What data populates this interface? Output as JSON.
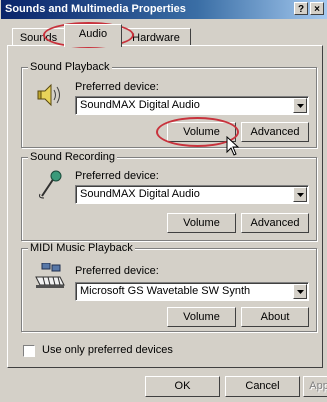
{
  "window": {
    "title": "Sounds and Multimedia Properties",
    "help_button": "?",
    "close_button": "×"
  },
  "tabs": [
    {
      "label": "Sounds",
      "active": false
    },
    {
      "label": "Audio",
      "active": true
    },
    {
      "label": "Hardware",
      "active": false
    }
  ],
  "sound_playback": {
    "legend": "Sound Playback",
    "icon": "speaker-icon",
    "device_label": "Preferred device:",
    "device_value": "SoundMAX Digital Audio",
    "volume_button": "Volume",
    "advanced_button": "Advanced"
  },
  "sound_recording": {
    "legend": "Sound Recording",
    "icon": "microphone-icon",
    "device_label": "Preferred device:",
    "device_value": "SoundMAX Digital Audio",
    "volume_button": "Volume",
    "advanced_button": "Advanced"
  },
  "midi_playback": {
    "legend": "MIDI Music Playback",
    "icon": "midi-keyboard-icon",
    "device_label": "Preferred device:",
    "device_value": "Microsoft GS Wavetable SW Synth",
    "volume_button": "Volume",
    "about_button": "About"
  },
  "options": {
    "use_preferred_label": "Use only preferred devices",
    "use_preferred_checked": false
  },
  "footer": {
    "ok_button": "OK",
    "cancel_button": "Cancel",
    "apply_button": "Apply"
  },
  "colors": {
    "title_start": "#0a246a",
    "title_end": "#a6caf0",
    "face": "#d4d0c8",
    "annotation": "#c8323c"
  }
}
